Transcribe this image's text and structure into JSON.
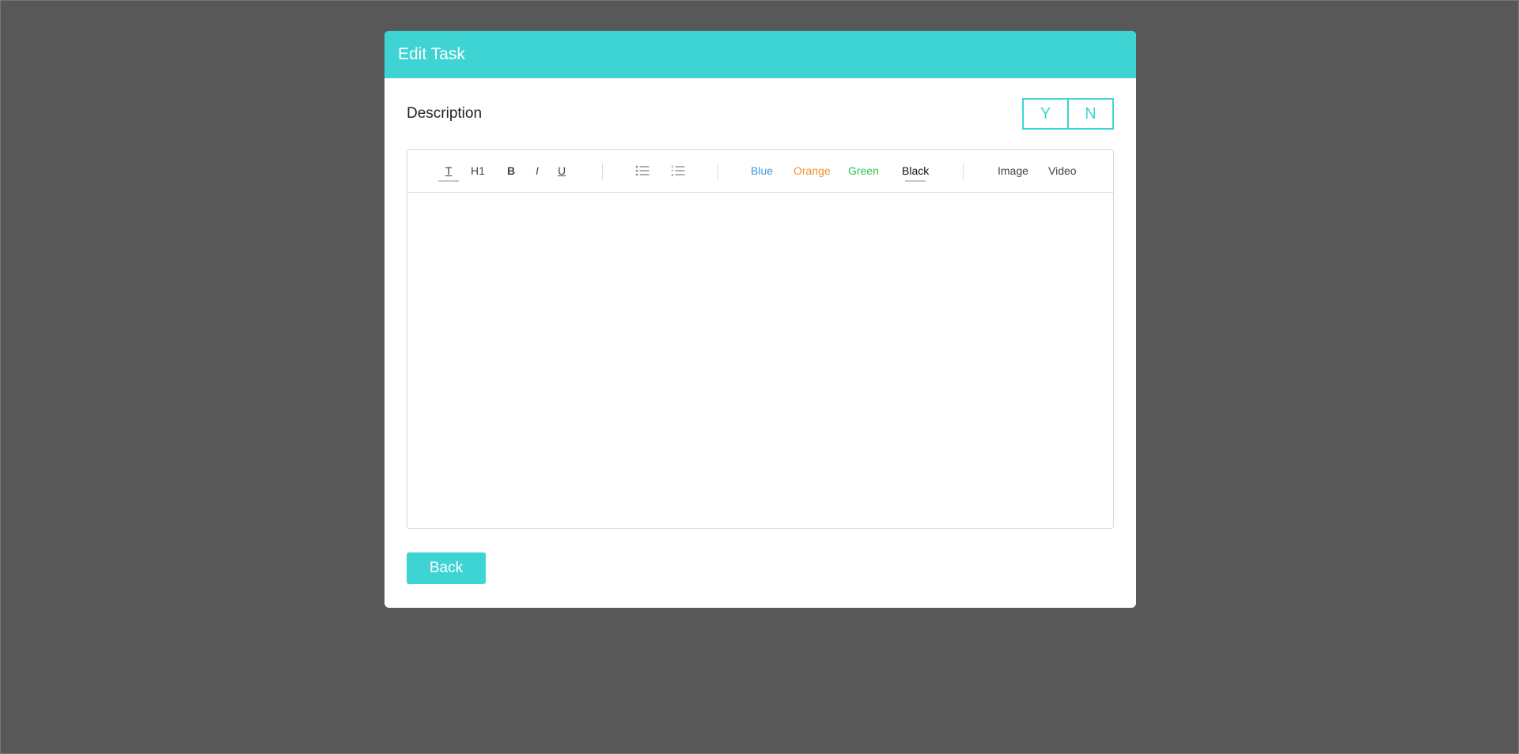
{
  "modal": {
    "title": "Edit Task"
  },
  "description": {
    "label": "Description",
    "yes_label": "Y",
    "no_label": "N"
  },
  "toolbar": {
    "text_label": "T",
    "h1_label": "H1",
    "bold_label": "B",
    "italic_label": "I",
    "underline_label": "U",
    "unordered_list_icon": "bulleted-list-icon",
    "ordered_list_icon": "numbered-list-icon",
    "colors": [
      {
        "label": "Blue",
        "color": "#3a9ad9"
      },
      {
        "label": "Orange",
        "color": "#f0922b"
      },
      {
        "label": "Green",
        "color": "#2bc44a"
      },
      {
        "label": "Black",
        "color": "#111111"
      }
    ],
    "image_label": "Image",
    "video_label": "Video"
  },
  "editor": {
    "content": ""
  },
  "footer": {
    "back_label": "Back"
  },
  "theme": {
    "accent": "#3fd4d4",
    "backdrop": "#585858"
  }
}
